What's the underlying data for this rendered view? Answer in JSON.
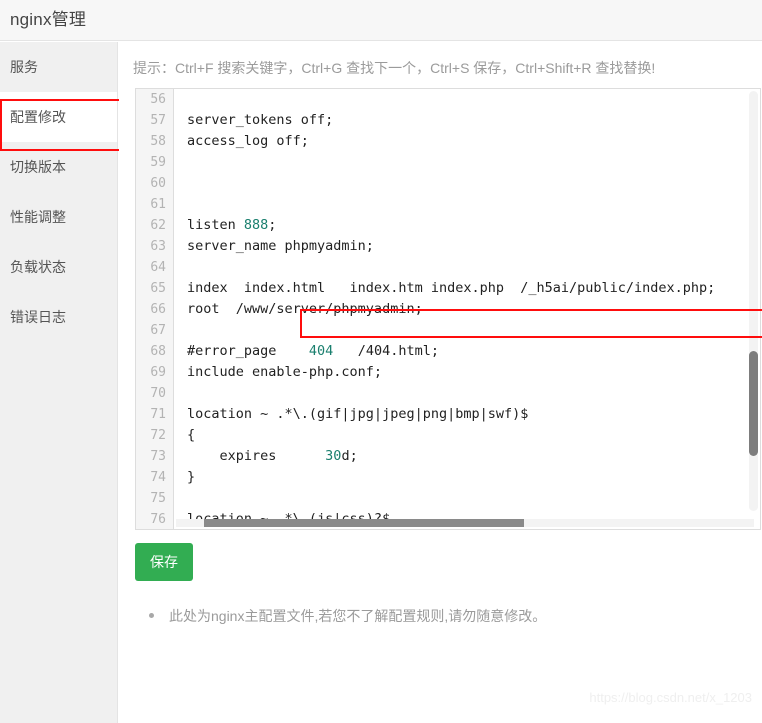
{
  "header": {
    "title": "nginx管理"
  },
  "sidebar": {
    "items": [
      {
        "label": "服务",
        "active": false
      },
      {
        "label": "配置修改",
        "active": true
      },
      {
        "label": "切换版本",
        "active": false
      },
      {
        "label": "性能调整",
        "active": false
      },
      {
        "label": "负载状态",
        "active": false
      },
      {
        "label": "错误日志",
        "active": false
      }
    ],
    "highlight_color": "#ff0d0d"
  },
  "main": {
    "hint": "提示：Ctrl+F 搜索关键字，Ctrl+G 查找下一个，Ctrl+S 保存，Ctrl+Shift+R 查找替换!",
    "save_label": "保存",
    "save_color": "#32ad52",
    "notes": [
      "此处为nginx主配置文件,若您不了解配置规则,请勿随意修改。"
    ]
  },
  "editor": {
    "first_line": 56,
    "highlight_line": 65,
    "highlight_color": "#ff0d0d",
    "lines": [
      {
        "n": 56,
        "text": ""
      },
      {
        "n": 57,
        "text": "server_tokens off;"
      },
      {
        "n": 58,
        "text": "access_log off;"
      },
      {
        "n": 59,
        "text": ""
      },
      {
        "n": 60,
        "text": ""
      },
      {
        "n": 61,
        "text": ""
      },
      {
        "n": 62,
        "text": "listen ",
        "num": "888",
        "tail": ";"
      },
      {
        "n": 63,
        "text": "server_name phpmyadmin;"
      },
      {
        "n": 64,
        "text": ""
      },
      {
        "n": 65,
        "text": "index  index.html   index.htm index.php  /_h5ai/public/index.php;"
      },
      {
        "n": 66,
        "text": "root  /www/server/phpmyadmin;"
      },
      {
        "n": 67,
        "text": ""
      },
      {
        "n": 68,
        "text": "#error_page    ",
        "num": "404",
        "tail": "   /404.html;"
      },
      {
        "n": 69,
        "text": "include enable-php.conf;"
      },
      {
        "n": 70,
        "text": ""
      },
      {
        "n": 71,
        "text": "location ~ .*\\.(gif|jpg|jpeg|png|bmp|swf)$"
      },
      {
        "n": 72,
        "text": "{"
      },
      {
        "n": 73,
        "text": "    expires      ",
        "num": "30",
        "tail": "d;"
      },
      {
        "n": 74,
        "text": "}"
      },
      {
        "n": 75,
        "text": ""
      },
      {
        "n": 76,
        "text": "location ~ .*\\.(js|css)?$"
      }
    ]
  },
  "watermark": {
    "text": "https://blog.csdn.net/x_1203"
  }
}
